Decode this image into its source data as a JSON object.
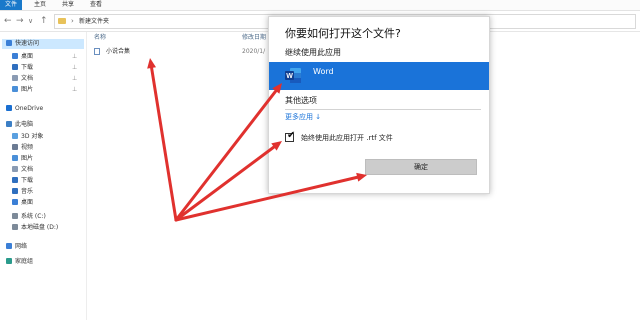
{
  "ribbon": {
    "tabs": [
      "文件",
      "主页",
      "共享",
      "查看"
    ]
  },
  "address": {
    "back": "←",
    "forward": "→",
    "down": "∨",
    "up": "↑",
    "separator": "›",
    "path": "新建文件夹"
  },
  "sidebar": {
    "items": [
      {
        "label": "快速访问",
        "color": "#3b7fd6"
      },
      {
        "label": "桌面",
        "color": "#3b7fd6",
        "pinned": true
      },
      {
        "label": "下载",
        "color": "#2f6fbf",
        "pinned": true
      },
      {
        "label": "文档",
        "color": "#8a9bb3",
        "pinned": true
      },
      {
        "label": "图片",
        "color": "#4a8fd8",
        "pinned": true
      },
      {
        "label": "OneDrive",
        "color": "#1a6fd1"
      },
      {
        "label": "此电脑",
        "color": "#3c7fc5"
      },
      {
        "label": "3D 对象",
        "color": "#5aa0e0"
      },
      {
        "label": "视频",
        "color": "#6b7b93"
      },
      {
        "label": "图片",
        "color": "#4a8fd8"
      },
      {
        "label": "文档",
        "color": "#8a9bb3"
      },
      {
        "label": "下载",
        "color": "#2f6fbf"
      },
      {
        "label": "音乐",
        "color": "#2f6fbf"
      },
      {
        "label": "桌面",
        "color": "#3b7fd6"
      },
      {
        "label": "系统 (C:)",
        "color": "#7d8a99"
      },
      {
        "label": "本地磁盘 (D:)",
        "color": "#7d8a99"
      },
      {
        "label": "网络",
        "color": "#3b7fd6"
      },
      {
        "label": "家庭组",
        "color": "#2a9b8c"
      }
    ],
    "pin_glyph": "⊥"
  },
  "columns": {
    "name": "名称",
    "date": "修改日期"
  },
  "files": [
    {
      "name": "小说合集",
      "date": "2020/1/"
    }
  ],
  "dialog": {
    "title": "你要如何打开这个文件?",
    "continue_label": "继续使用此应用",
    "app_name": "Word",
    "other_label": "其他选项",
    "more_apps": "更多应用 ↓",
    "checkbox_label": "始终使用此应用打开 .rtf 文件",
    "checkbox_checked": true,
    "check_glyph": "✔",
    "ok_label": "确定",
    "accent_color": "#1a73d9"
  },
  "annotation_color": "#e0312e"
}
